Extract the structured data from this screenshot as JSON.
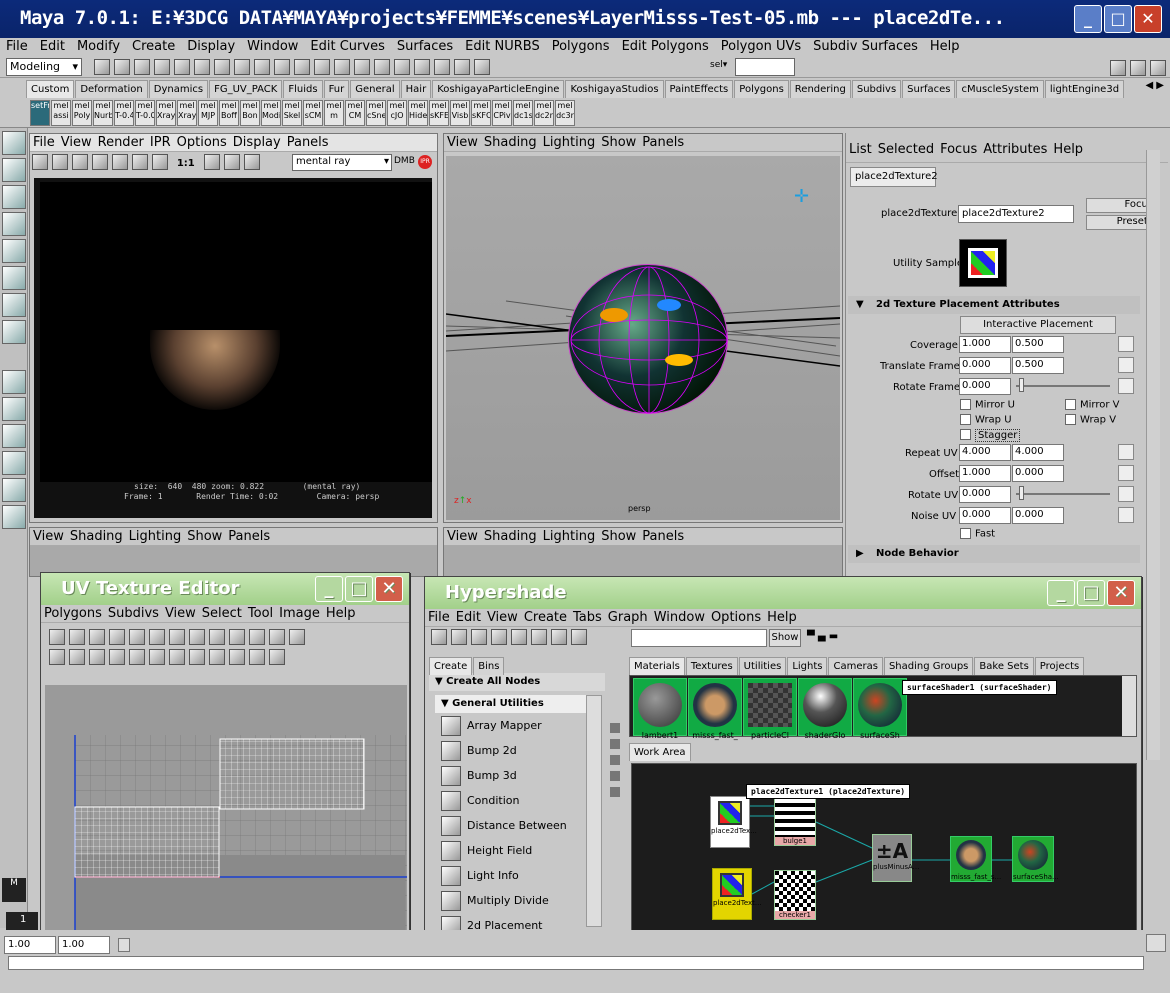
{
  "titlebar": {
    "title": "Maya 7.0.1: E:¥3DCG DATA¥MAYA¥projects¥FEMME¥scenes¥LayerMisss-Test-05.mb   ---   place2dTe..."
  },
  "main_menu": [
    "File",
    "Edit",
    "Modify",
    "Create",
    "Display",
    "Window",
    "Edit Curves",
    "Surfaces",
    "Edit NURBS",
    "Polygons",
    "Edit Polygons",
    "Polygon UVs",
    "Subdiv Surfaces",
    "Help"
  ],
  "status_line": {
    "mode": "Modeling",
    "sel_label": "sel▾"
  },
  "shelf_tabs": [
    "Custom",
    "Deformation",
    "Dynamics",
    "FG_UV_PACK",
    "Fluids",
    "Fur",
    "General",
    "Hair",
    "KoshigayaParticleEngine",
    "KoshigayaStudios",
    "PaintEffects",
    "Polygons",
    "Rendering",
    "Subdivs",
    "Surfaces",
    "cMuscleSystem",
    "lightEngine3d"
  ],
  "shelf_buttons": [
    "setFr",
    "assi",
    "Poly",
    "Nurb",
    "T-0.4",
    "T-0.0",
    "Xray",
    "Xray",
    "MJP",
    "Boff",
    "Bon",
    "Modi",
    "Skel",
    "sCM",
    "m",
    "CM",
    "cSne",
    "cJO",
    "Hide",
    "sKFE",
    "Visb",
    "sKFC",
    "CPiv",
    "dc1s",
    "dc2n",
    "dc3r"
  ],
  "render_view": {
    "menu": [
      "File",
      "View",
      "Render",
      "IPR",
      "Options",
      "Display",
      "Panels"
    ],
    "renderer": "mental ray",
    "ratio": "1:1",
    "info_line1": "size:  640  480 zoom: 0.822        (mental ray)",
    "info_line2": "Frame: 1       Render Time: 0:02        Camera: persp",
    "extra_a": "DMB",
    "extra_b": "IPR"
  },
  "persp_view": {
    "menu": [
      "View",
      "Shading",
      "Lighting",
      "Show",
      "Panels"
    ],
    "camera_label": "persp"
  },
  "bottom_views": {
    "menu": [
      "View",
      "Shading",
      "Lighting",
      "Show",
      "Panels"
    ]
  },
  "attribute_editor": {
    "menu": [
      "List",
      "Selected",
      "Focus",
      "Attributes",
      "Help"
    ],
    "tab": "place2dTexture2",
    "node_label": "place2dTexture:",
    "node_name": "place2dTexture2",
    "focus_btn": "Focus",
    "presets_btn": "Presets",
    "utility_sample": "Utility Sample",
    "section_title": "2d Texture Placement Attributes",
    "interactive_btn": "Interactive Placement",
    "coverage": {
      "label": "Coverage",
      "u": "1.000",
      "v": "0.500"
    },
    "translate_frame": {
      "label": "Translate Frame",
      "u": "0.000",
      "v": "0.500"
    },
    "rotate_frame": {
      "label": "Rotate Frame",
      "val": "0.000"
    },
    "mirror_u": "Mirror U",
    "mirror_v": "Mirror V",
    "wrap_u": "Wrap U",
    "wrap_v": "Wrap V",
    "stagger": "Stagger",
    "repeat_uv": {
      "label": "Repeat UV",
      "u": "4.000",
      "v": "4.000"
    },
    "offset": {
      "label": "Offset",
      "u": "1.000",
      "v": "0.000"
    },
    "rotate_uv": {
      "label": "Rotate UV",
      "val": "0.000"
    },
    "noise_uv": {
      "label": "Noise UV",
      "u": "0.000",
      "v": "0.000"
    },
    "fast": "Fast",
    "node_behavior": "Node Behavior"
  },
  "uv_editor": {
    "title": "UV Texture Editor",
    "menu": [
      "Polygons",
      "Subdivs",
      "View",
      "Select",
      "Tool",
      "Image",
      "Help"
    ]
  },
  "hypershade": {
    "title": "Hypershade",
    "menu": [
      "File",
      "Edit",
      "View",
      "Create",
      "Tabs",
      "Graph",
      "Window",
      "Options",
      "Help"
    ],
    "show_btn": "Show",
    "left_tabs": [
      "Create",
      "Bins"
    ],
    "create_all": "Create All Nodes",
    "general_utilities": "General Utilities",
    "utilities": [
      "Array Mapper",
      "Bump 2d",
      "Bump 3d",
      "Condition",
      "Distance Between",
      "Height Field",
      "Light Info",
      "Multiply Divide",
      "2d Placement"
    ],
    "top_tabs": [
      "Materials",
      "Textures",
      "Utilities",
      "Lights",
      "Cameras",
      "Shading Groups",
      "Bake Sets",
      "Projects"
    ],
    "swatches": [
      "lambert1",
      "misss_fast_",
      "particleCl",
      "shaderGlo",
      "surfaceSh"
    ],
    "tooltip_top": "surfaceShader1 (surfaceShader)",
    "work_area_tab": "Work Area",
    "tooltip_work": "place2dTexture1 (place2dTexture)",
    "nodes": [
      "place2dTex...",
      "bulge1",
      "plusMinusA...",
      "misss_fast_s...",
      "surfaceSha...",
      "place2dText...",
      "checker1"
    ],
    "nav_left": "<<",
    "nav_right": ">>"
  },
  "time_fields": {
    "a": "1.00",
    "b": "1.00",
    "frame": "1"
  }
}
